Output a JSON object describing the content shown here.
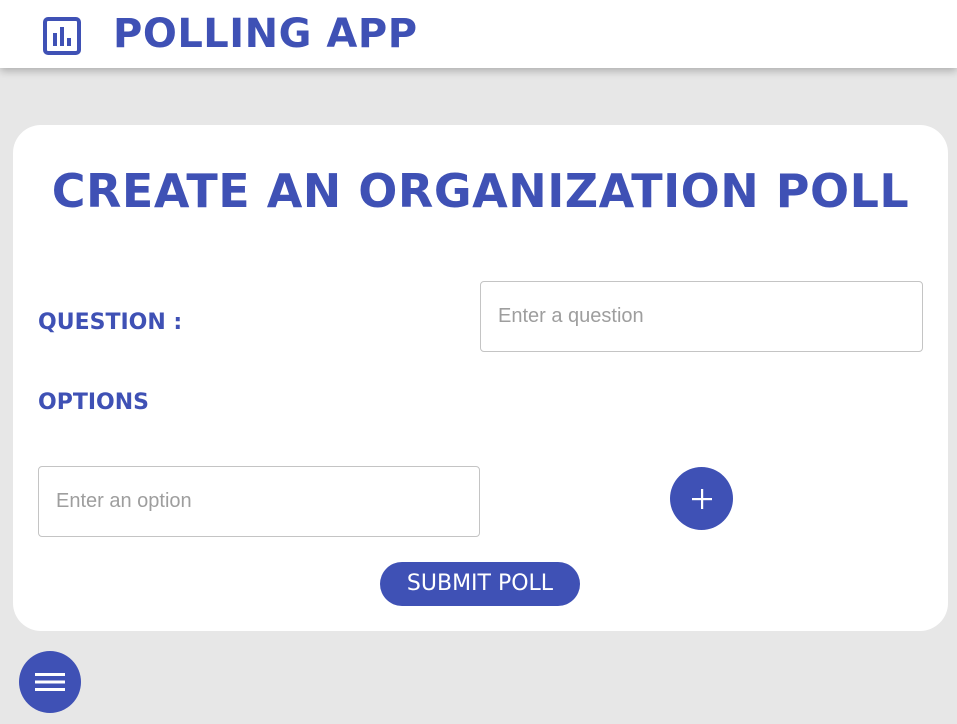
{
  "header": {
    "logo_icon": "poll-chart-icon",
    "title": "POLLING APP"
  },
  "form": {
    "title": "CREATE AN ORGANIZATION POLL",
    "question_label": "QUESTION :",
    "question_placeholder": "Enter a question",
    "question_value": "",
    "options_label": "OPTIONS",
    "option_placeholder": "Enter an option",
    "option_value": "",
    "add_option_icon": "plus-icon",
    "submit_label": "SUBMIT POLL"
  },
  "fab": {
    "icon": "hamburger-menu-icon"
  },
  "colors": {
    "accent": "#3f51b5",
    "background": "#e7e7e7",
    "card": "#ffffff"
  }
}
